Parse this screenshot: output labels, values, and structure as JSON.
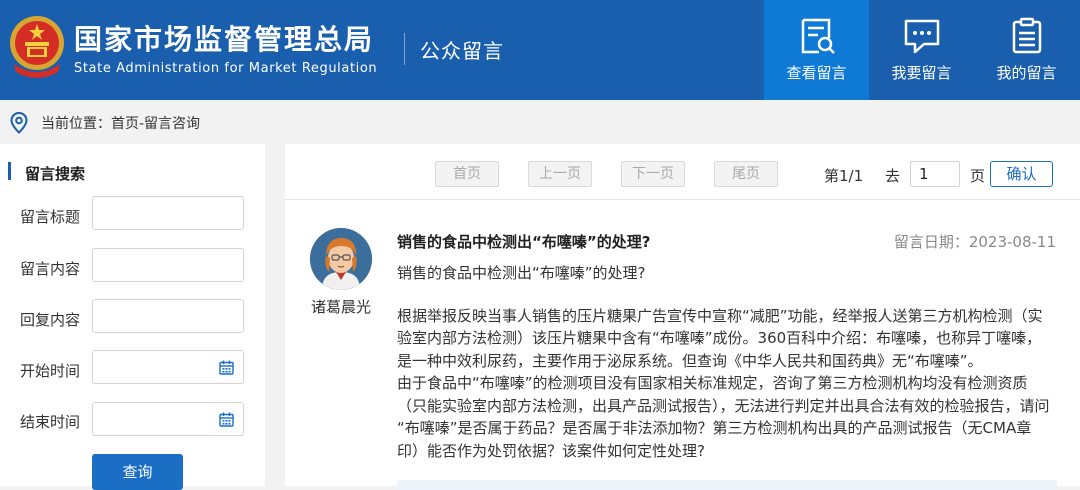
{
  "header": {
    "brand_cn": "国家市场监督管理总局",
    "brand_en": "State Administration for Market Regulation",
    "subtitle": "公众留言",
    "nav": [
      {
        "label": "查看留言",
        "icon": "view-messages-icon",
        "active": true
      },
      {
        "label": "我要留言",
        "icon": "chat-bubble-icon",
        "active": false
      },
      {
        "label": "我的留言",
        "icon": "clipboard-list-icon",
        "active": false
      }
    ]
  },
  "breadcrumb": {
    "text": "当前位置：首页-留言咨询",
    "icon": "location-pin-icon"
  },
  "search": {
    "title": "留言搜索",
    "fields": {
      "title_label": "留言标题",
      "content_label": "留言内容",
      "reply_label": "回复内容",
      "start_label": "开始时间",
      "end_label": "结束时间"
    },
    "submit_label": "查询"
  },
  "pager": {
    "first": "首页",
    "prev": "上一页",
    "next": "下一页",
    "last": "尾页",
    "page_info": "第1/1",
    "goto_label": "去",
    "goto_value": "1",
    "page_unit": "页",
    "confirm": "确认"
  },
  "message": {
    "author": "诸葛晨光",
    "title": "销售的食品中检测出“布噻嗪”的处理?",
    "date": "留言日期：2023-08-11",
    "body_lead": "销售的食品中检测出“布噻嗪”的处理?",
    "body_lines": [
      "根据举报反映当事人销售的压片糖果广告宣传中宣称“减肥”功能，经举报人送第三方机构检测（实",
      "验室内部方法检测）该压片糖果中含有“布噻嗪”成份。360百科中介绍：布噻嗪，也称异丁噻嗪，",
      "是一种中效利尿药，主要作用于泌尿系统。但查询《中华人民共和国药典》无“布噻嗪”。",
      "由于食品中“布噻嗪”的检测项目没有国家相关标准规定，咨询了第三方检测机构均没有检测资质",
      "（只能实验室内部方法检测，出具产品测试报告），无法进行判定并出具合法有效的检验报告，请问",
      "“布噻嗪”是否属于药品？是否属于非法添加物？第三方检测机构出具的产品测试报告（无CMA章",
      "印）能否作为处罚依据？该案件如何定性处理?"
    ]
  },
  "colors": {
    "header_blue": "#1a5fad",
    "active_nav": "#0f7ad5",
    "button_blue": "#1a6fc5"
  }
}
